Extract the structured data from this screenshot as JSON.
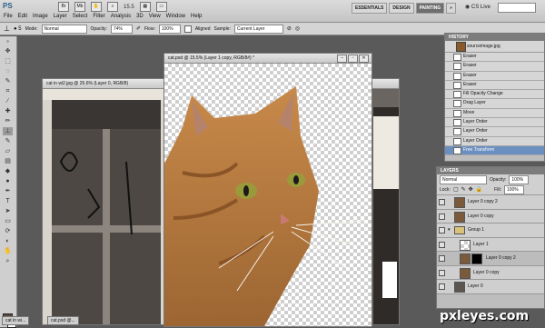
{
  "app": {
    "logo": "PS",
    "zoom": "15.5",
    "cs_live": "CS Live"
  },
  "menu": [
    "File",
    "Edit",
    "Image",
    "Layer",
    "Select",
    "Filter",
    "Analysis",
    "3D",
    "View",
    "Window",
    "Help"
  ],
  "workspaces": [
    "ESSENTIALS",
    "DESIGN",
    "PAINTING"
  ],
  "options": {
    "mode_label": "Mode:",
    "mode": "Normal",
    "opacity_label": "Opacity:",
    "opacity": "74%",
    "flow_label": "Flow:",
    "flow": "100%",
    "aligned_label": "Aligned",
    "sample_label": "Sample:",
    "sample": "Current Layer"
  },
  "documents": {
    "back": {
      "title": "cat in wi2.jpg @ 25.6% (Layer 0, RGB/8)"
    },
    "front": {
      "title": "cat.psd @ 15.5% (Layer 1 copy, RGB/8#) *"
    },
    "minimized": [
      "cat in wi...",
      "cat.psd @..."
    ]
  },
  "history": {
    "tab": "HISTORY",
    "snapshot": "sourceimage.jpg",
    "items": [
      "Eraser",
      "Eraser",
      "Eraser",
      "Eraser",
      "Fill Opacity Change",
      "Drag Layer",
      "Move",
      "Layer Order",
      "Layer Order",
      "Layer Order",
      "Free Transform"
    ]
  },
  "layers": {
    "tab": "LAYERS",
    "blend": "Normal",
    "opacity_label": "Opacity:",
    "opacity": "100%",
    "lock_label": "Lock:",
    "fill_label": "Fill:",
    "fill": "100%",
    "items": [
      "Layer 0 copy 2",
      "Layer 0 copy",
      "Group 1",
      "Layer 1",
      "Layer 0 copy 2",
      "Layer 0 copy",
      "Layer 0"
    ]
  },
  "watermark": "pxleyes.com"
}
